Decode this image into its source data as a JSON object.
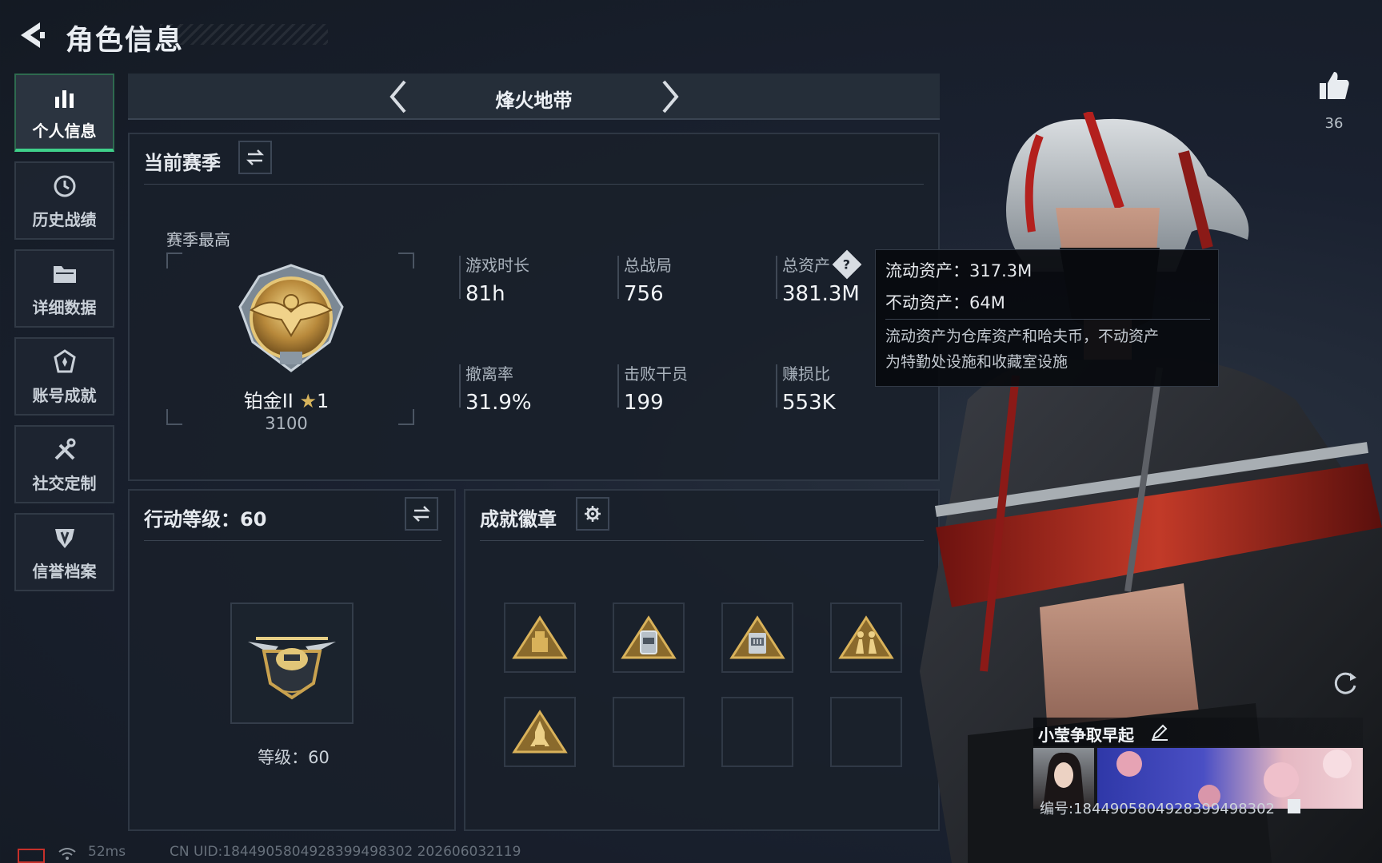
{
  "header": {
    "title": "角色信息"
  },
  "nav": {
    "items": [
      {
        "label": "个人信息",
        "icon": "bar-chart-icon",
        "active": true
      },
      {
        "label": "历史战绩",
        "icon": "history-icon",
        "active": false
      },
      {
        "label": "详细数据",
        "icon": "folder-icon",
        "active": false
      },
      {
        "label": "账号成就",
        "icon": "achievement-icon",
        "active": false
      },
      {
        "label": "社交定制",
        "icon": "tools-icon",
        "active": false
      },
      {
        "label": "信誉档案",
        "icon": "shield-icon",
        "active": false
      }
    ]
  },
  "map_selector": {
    "title": "烽火地带"
  },
  "season": {
    "title": "当前赛季",
    "best_label": "赛季最高",
    "rank_name": "铂金II",
    "rank_stars": "1",
    "rank_points": "3100",
    "stats": [
      {
        "label": "游戏时长",
        "value": "81h"
      },
      {
        "label": "总战局",
        "value": "756"
      },
      {
        "label": "总资产",
        "value": "381.3M"
      },
      {
        "label": "撤离率",
        "value": "31.9%"
      },
      {
        "label": "击败干员",
        "value": "199"
      },
      {
        "label": "赚损比",
        "value": "553K"
      }
    ]
  },
  "tooltip": {
    "liquid": "流动资产：317.3M",
    "fixed": "不动资产：64M",
    "desc_line1": "流动资产为仓库资产和哈夫币，不动资产",
    "desc_line2": "为特勤处设施和收藏室设施"
  },
  "action_level": {
    "title": "行动等级：60",
    "level_label": "等级：60"
  },
  "badges": {
    "title": "成就徽章",
    "items": [
      {
        "icon": "badge-cargo-icon",
        "filled": true,
        "color": "#c59a3e"
      },
      {
        "icon": "badge-canister-icon",
        "filled": true,
        "color": "#c59a3e"
      },
      {
        "icon": "badge-58-icon",
        "filled": true,
        "color": "#c59a3e"
      },
      {
        "icon": "badge-soldiers-icon",
        "filled": true,
        "color": "#c59a3e"
      },
      {
        "icon": "badge-rocket-icon",
        "filled": true,
        "color": "#c59a3e"
      },
      {
        "filled": false
      },
      {
        "filled": false
      },
      {
        "filled": false
      }
    ]
  },
  "likes": {
    "count": "36"
  },
  "player_card": {
    "name": "小莹争取早起",
    "id_line": "编号:1844905804928399498302"
  },
  "footer": {
    "ping": "52ms",
    "uid": "CN UID:1844905804928399498302  202606032119"
  },
  "colors": {
    "accent_green": "#3fd08a",
    "gold": "#c59a3e",
    "panel_bg": "#19202a"
  }
}
